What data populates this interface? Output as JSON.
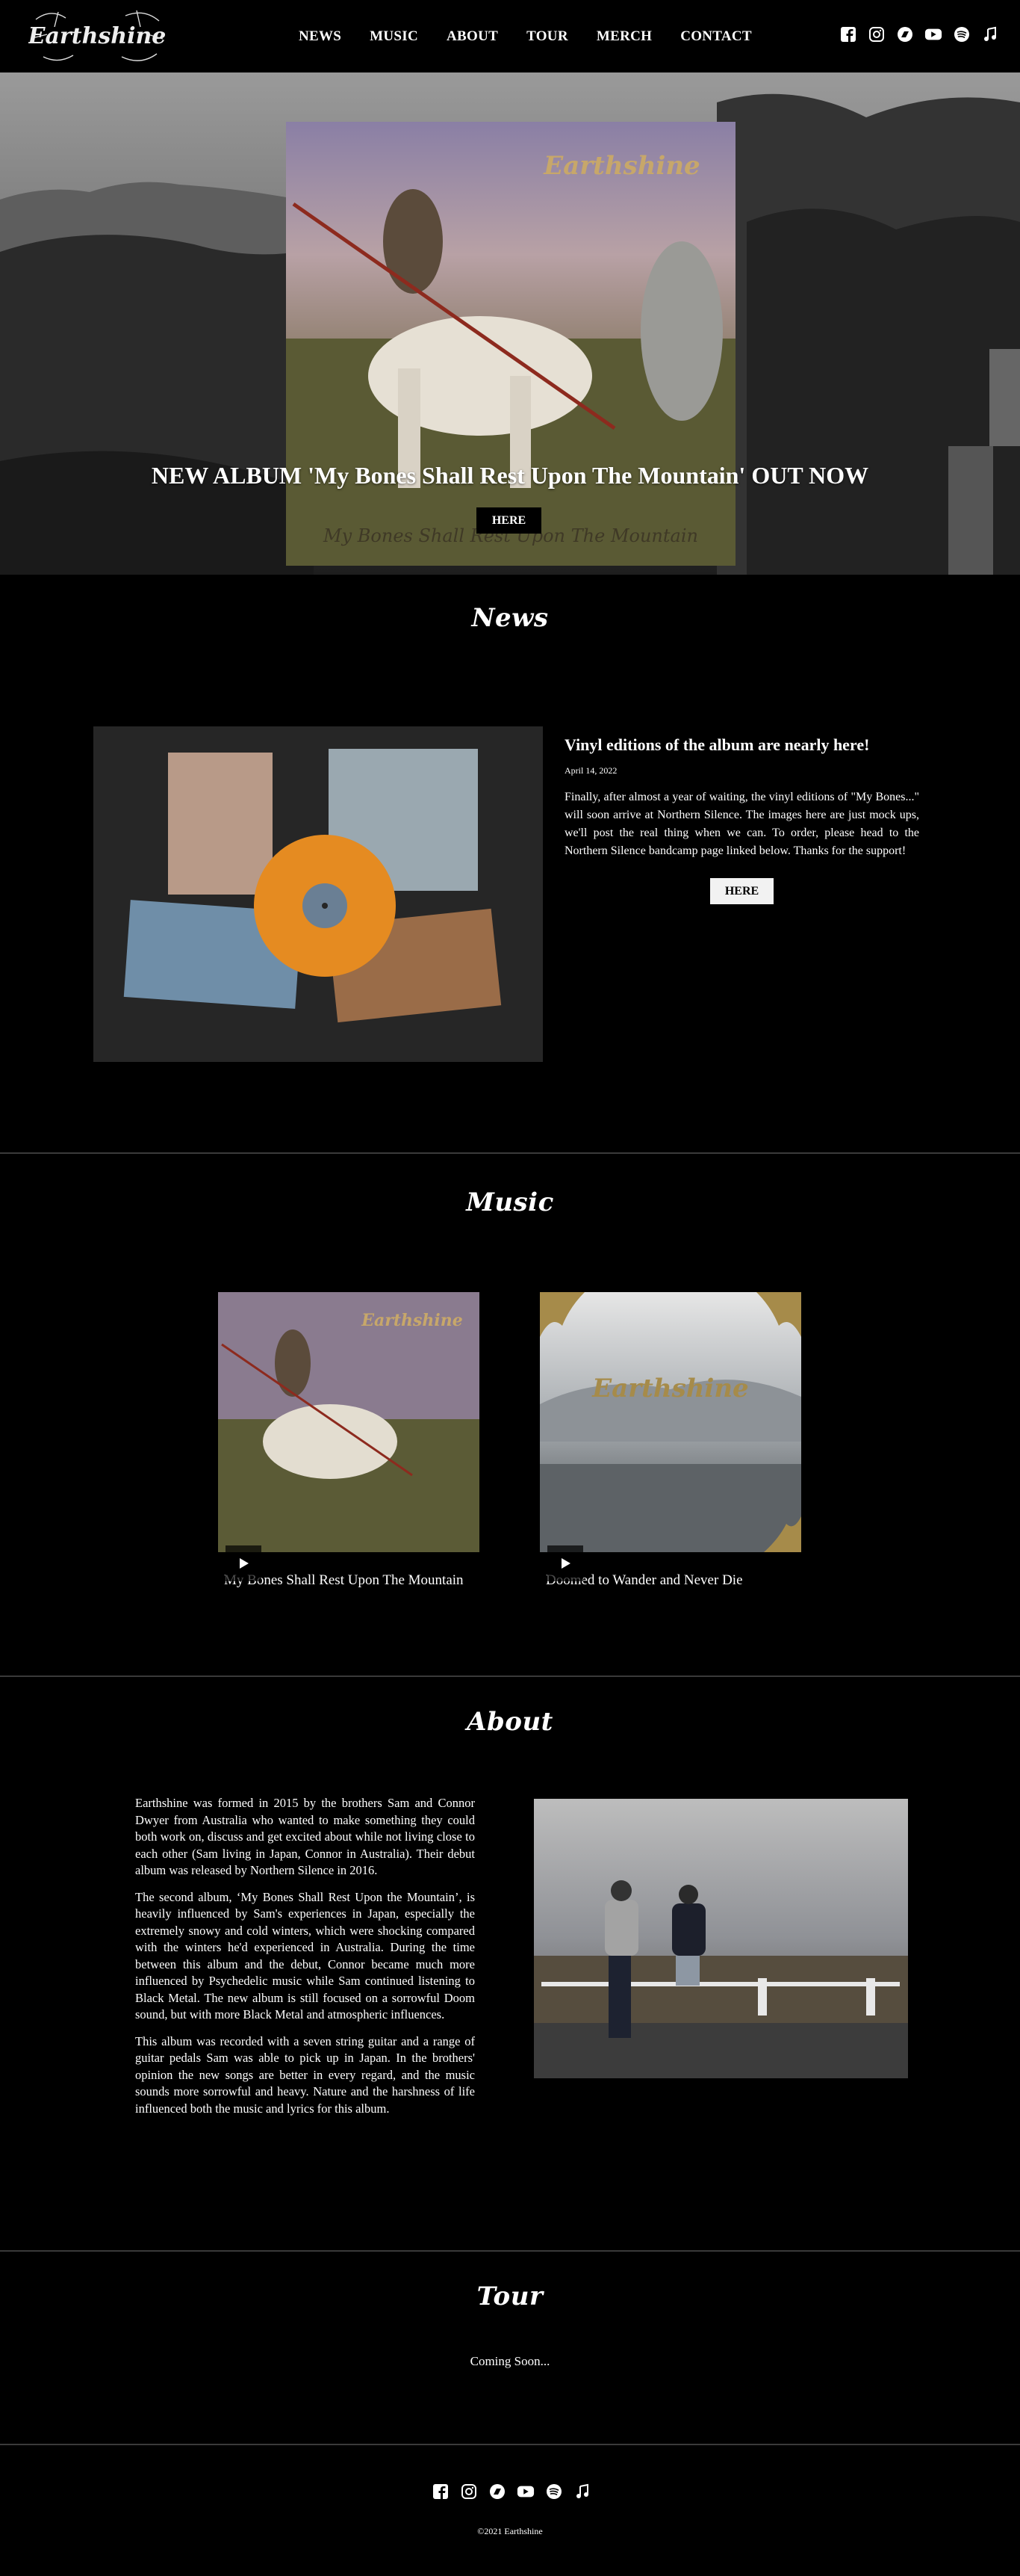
{
  "header": {
    "logo_text": "Earthshine",
    "nav": [
      "NEWS",
      "MUSIC",
      "ABOUT",
      "TOUR",
      "MERCH",
      "CONTACT"
    ],
    "social_icons": [
      "facebook-icon",
      "instagram-icon",
      "bandcamp-icon",
      "youtube-icon",
      "spotify-icon",
      "apple-music-icon"
    ]
  },
  "hero": {
    "title": "NEW ALBUM 'My Bones Shall Rest Upon The Mountain' OUT NOW",
    "button": "HERE",
    "album_subtitle": "My Bones Shall Rest Upon The Mountain"
  },
  "news": {
    "title": "News",
    "headline": "Vinyl editions of the album are nearly here!",
    "date": "April 14, 2022",
    "body": "Finally, after almost a year of waiting, the vinyl editions of \"My Bones...\" will soon arrive at Northern Silence. The images here are just mock ups, we'll post the real thing when we can. To order, please head to the Northern Silence bandcamp page linked below. Thanks for the support!",
    "button": "HERE"
  },
  "music": {
    "title": "Music",
    "tracks": [
      {
        "name": "My Bones Shall Rest Upon The Mountain"
      },
      {
        "name": "Doomed to Wander and Never Die"
      }
    ]
  },
  "about": {
    "title": "About",
    "paragraphs": [
      "Earthshine was formed in 2015 by the brothers Sam and Connor Dwyer from Australia who wanted to make something they could both work on, discuss and get excited about while not living close to each other (Sam living in Japan, Connor in Australia). Their debut album was released by Northern Silence in 2016.",
      "The second album, ‘My Bones Shall Rest Upon the Mountain’, is heavily influenced by Sam's experiences in Japan, especially the extremely snowy and cold winters, which were shocking compared with the winters he'd experienced in Australia. During the time between this album and the debut, Connor became much more influenced by Psychedelic music while Sam continued listening to Black Metal. The new album is still focused on a sorrowful Doom sound, but with more Black Metal and atmospheric influences.",
      "This album was recorded with a seven string guitar and a range of guitar pedals Sam was able to pick up in Japan. In the brothers' opinion the new songs are better in every regard, and the music sounds more sorrowful and heavy. Nature and the harshness of life influenced both the music and lyrics for this album."
    ]
  },
  "tour": {
    "title": "Tour",
    "text": "Coming Soon..."
  },
  "footer": {
    "copyright": "©2021 Earthshine"
  }
}
